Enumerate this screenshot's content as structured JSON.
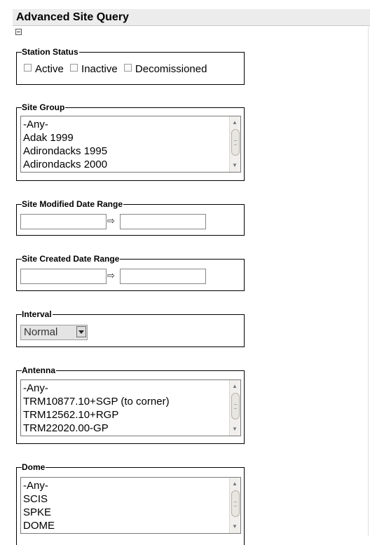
{
  "header": {
    "title": "Advanced Site Query"
  },
  "station_status": {
    "legend": "Station Status",
    "options": [
      "Active",
      "Inactive",
      "Decomissioned"
    ]
  },
  "site_group": {
    "legend": "Site Group",
    "options": [
      "-Any-",
      "Adak 1999",
      "Adirondacks 1995",
      "Adirondacks 2000"
    ]
  },
  "site_modified": {
    "legend": "Site Modified Date Range",
    "from_value": "",
    "to_value": ""
  },
  "site_created": {
    "legend": "Site Created Date Range",
    "from_value": "",
    "to_value": ""
  },
  "interval": {
    "legend": "Interval",
    "selected": "Normal"
  },
  "antenna": {
    "legend": "Antenna",
    "options": [
      "-Any-",
      "TRM10877.10+SGP (to corner)",
      "TRM12562.10+RGP",
      "TRM22020.00-GP"
    ]
  },
  "dome": {
    "legend": "Dome",
    "options": [
      "-Any-",
      "SCIS",
      "SPKE",
      "DOME"
    ]
  },
  "icons": {
    "collapse": "minus-box-icon",
    "range_arrow": "right-arrow-icon"
  }
}
